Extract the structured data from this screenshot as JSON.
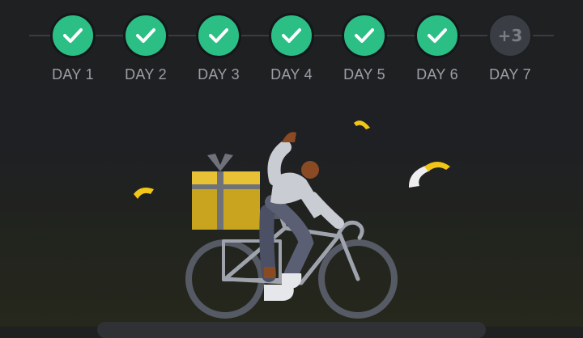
{
  "progress": {
    "days": [
      {
        "label": "DAY 1",
        "status": "completed",
        "icon": "check-icon"
      },
      {
        "label": "DAY 2",
        "status": "completed",
        "icon": "check-icon"
      },
      {
        "label": "DAY 3",
        "status": "completed",
        "icon": "check-icon"
      },
      {
        "label": "DAY 4",
        "status": "completed",
        "icon": "check-icon"
      },
      {
        "label": "DAY 5",
        "status": "completed",
        "icon": "check-icon"
      },
      {
        "label": "DAY 6",
        "status": "completed",
        "icon": "check-icon"
      },
      {
        "label": "DAY 7",
        "status": "pending",
        "reward": "+3"
      }
    ],
    "completed_color": "#2bbf85",
    "pending_color": "#3b3d45"
  },
  "illustration": {
    "subject": "cyclist-with-gift",
    "gift_color": "#e8c234",
    "confetti_color": "#f2c619"
  }
}
